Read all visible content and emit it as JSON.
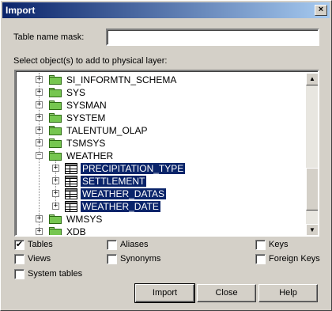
{
  "window": {
    "title": "Import",
    "close_glyph": "×"
  },
  "mask": {
    "label": "Table name mask:",
    "value": ""
  },
  "tree_label": "Select object(s) to add to physical layer:",
  "tree": [
    {
      "label": "SI_INFORMTN_SCHEMA",
      "expander": "+",
      "selected": false
    },
    {
      "label": "SYS",
      "expander": "+",
      "selected": false
    },
    {
      "label": "SYSMAN",
      "expander": "+",
      "selected": false
    },
    {
      "label": "SYSTEM",
      "expander": "+",
      "selected": false
    },
    {
      "label": "TALENTUM_OLAP",
      "expander": "+",
      "selected": false
    },
    {
      "label": "TSMSYS",
      "expander": "+",
      "selected": false
    },
    {
      "label": "WEATHER",
      "expander": "−",
      "selected": false
    },
    {
      "label": "PRECIPITATION_TYPE",
      "expander": "+",
      "selected": true
    },
    {
      "label": "SETTLEMENT",
      "expander": "+",
      "selected": true
    },
    {
      "label": "WEATHER_DATAS",
      "expander": "+",
      "selected": true
    },
    {
      "label": "WEATHER_DATE",
      "expander": "+",
      "selected": true
    },
    {
      "label": "WMSYS",
      "expander": "+",
      "selected": false
    },
    {
      "label": "XDB",
      "expander": "+",
      "selected": false
    }
  ],
  "scroll": {
    "up_glyph": "▲",
    "down_glyph": "▼"
  },
  "options": {
    "tables": {
      "label": "Tables",
      "checked": true
    },
    "views": {
      "label": "Views",
      "checked": false
    },
    "system_tables": {
      "label": "System tables",
      "checked": false
    },
    "aliases": {
      "label": "Aliases",
      "checked": false
    },
    "synonyms": {
      "label": "Synonyms",
      "checked": false
    },
    "keys": {
      "label": "Keys",
      "checked": false
    },
    "foreign_keys": {
      "label": "Foreign Keys",
      "checked": false
    },
    "check_glyph": "✔"
  },
  "buttons": {
    "import": "Import",
    "close": "Close",
    "help": "Help"
  },
  "colors": {
    "selection": "#0a246a",
    "title_start": "#0a246a",
    "title_end": "#a6caf0"
  }
}
